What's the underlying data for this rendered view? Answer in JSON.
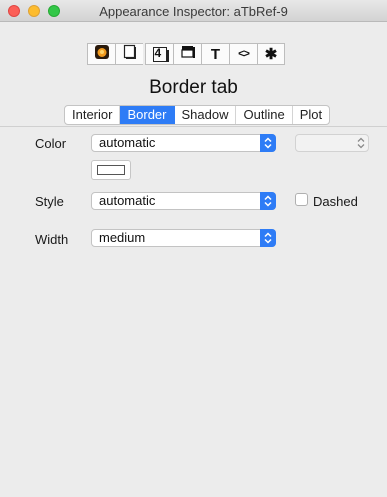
{
  "window": {
    "title": "Appearance Inspector: aTbRef-9"
  },
  "toolbar": {
    "buttons": [
      {
        "icon": "appearance-icon"
      },
      {
        "icon": "page-icon"
      },
      {
        "icon": "badge-number-icon",
        "text": "4"
      },
      {
        "icon": "border-icon"
      },
      {
        "icon": "text-icon",
        "text": "T"
      },
      {
        "icon": "code-icon",
        "text": "<>"
      },
      {
        "icon": "gear-icon",
        "text": "✱"
      }
    ]
  },
  "header": {
    "tab_name": "Border tab"
  },
  "tabs": [
    {
      "label": "Interior"
    },
    {
      "label": "Border",
      "active": true
    },
    {
      "label": "Shadow"
    },
    {
      "label": "Outline"
    },
    {
      "label": "Plot"
    }
  ],
  "form": {
    "color": {
      "label": "Color",
      "value": "automatic"
    },
    "style": {
      "label": "Style",
      "value": "automatic"
    },
    "dashed": {
      "label": "Dashed",
      "checked": false
    },
    "width": {
      "label": "Width",
      "value": "medium"
    }
  },
  "colors": {
    "accent": "#2e7cf6",
    "window_bg": "#ececec"
  }
}
